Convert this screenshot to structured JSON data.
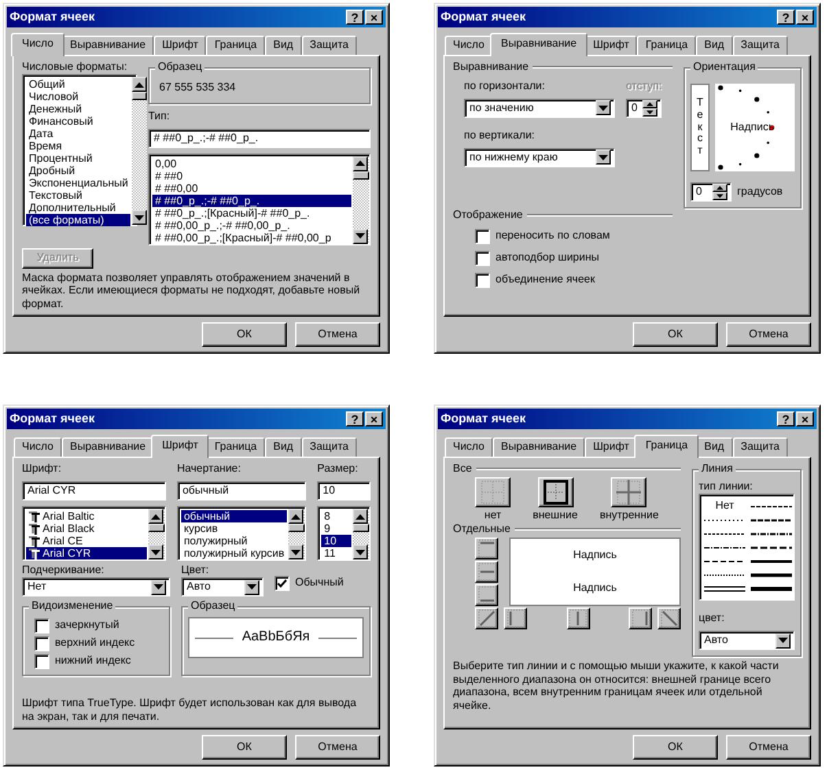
{
  "dialogs": [
    {
      "kind": "number",
      "title": "Формат ячеек",
      "title_buttons": [
        "?",
        "×"
      ],
      "tabs": [
        {
          "label": "Число",
          "selected": true
        },
        {
          "label": "Выравнивание",
          "selected": false
        },
        {
          "label": "Шрифт",
          "selected": false
        },
        {
          "label": "Граница",
          "selected": false
        },
        {
          "label": "Вид",
          "selected": false
        },
        {
          "label": "Защита",
          "selected": false
        }
      ],
      "formats_label": "Числовые форматы:",
      "formats": [
        {
          "label": "Общий",
          "selected": false
        },
        {
          "label": "Числовой",
          "selected": false
        },
        {
          "label": "Денежный",
          "selected": false
        },
        {
          "label": "Финансовый",
          "selected": false
        },
        {
          "label": "Дата",
          "selected": false
        },
        {
          "label": "Время",
          "selected": false
        },
        {
          "label": "Процентный",
          "selected": false
        },
        {
          "label": "Дробный",
          "selected": false
        },
        {
          "label": "Экспоненциальный",
          "selected": false
        },
        {
          "label": "Текстовый",
          "selected": false
        },
        {
          "label": "Дополнительный",
          "selected": false
        },
        {
          "label": "(все форматы)",
          "selected": true
        }
      ],
      "sample_label": "Образец",
      "sample_value": "67 555 535 334",
      "type_label": "Тип:",
      "type_value": "# ##0_р_.;-# ##0_р_.",
      "types": [
        {
          "label": "0,00",
          "selected": false
        },
        {
          "label": "# ##0",
          "selected": false
        },
        {
          "label": "# ##0,00",
          "selected": false
        },
        {
          "label": "# ##0_р_.;-# ##0_р_.",
          "selected": true
        },
        {
          "label": "# ##0_р_.;[Красный]-# ##0_р_.",
          "selected": false
        },
        {
          "label": "# ##0,00_р_.;-# ##0,00_р_.",
          "selected": false
        },
        {
          "label": "# ##0,00_р_.;[Красный]-# ##0,00_р",
          "selected": false
        }
      ],
      "delete_button": {
        "label": "Удалить",
        "disabled": true
      },
      "hint": "Маска формата позволяет управлять отображением значений в ячейках. Если имеющиеся форматы не подходят, добавьте новый формат.",
      "buttons": [
        "ОК",
        "Отмена"
      ]
    },
    {
      "kind": "alignment",
      "title": "Формат ячеек",
      "title_buttons": [
        "?",
        "×"
      ],
      "tabs": [
        {
          "label": "Число",
          "selected": false
        },
        {
          "label": "Выравнивание",
          "selected": true
        },
        {
          "label": "Шрифт",
          "selected": false
        },
        {
          "label": "Граница",
          "selected": false
        },
        {
          "label": "Вид",
          "selected": false
        },
        {
          "label": "Защита",
          "selected": false
        }
      ],
      "alignment_title": "Выравнивание",
      "horizontal_label": "по горизонтали:",
      "horizontal_value": "по значению",
      "indent": {
        "label": "отступ:",
        "value": "0",
        "disabled": true
      },
      "vertical_label": "по вертикали:",
      "vertical_value": "по нижнему краю",
      "display_title": "Отображение",
      "checkboxes": [
        {
          "label": "переносить по словам",
          "checked": false
        },
        {
          "label": "автоподбор ширины",
          "checked": false
        },
        {
          "label": "объединение ячеек",
          "checked": false
        }
      ],
      "orientation_title": "Ориентация",
      "vertical_text": "Текст",
      "rotated_text": "Надпись",
      "degrees_value": "0",
      "degrees_label": "градусов",
      "buttons": [
        "ОК",
        "Отмена"
      ]
    },
    {
      "kind": "font",
      "title": "Формат ячеек",
      "title_buttons": [
        "?",
        "×"
      ],
      "tabs": [
        {
          "label": "Число",
          "selected": false
        },
        {
          "label": "Выравнивание",
          "selected": false
        },
        {
          "label": "Шрифт",
          "selected": true
        },
        {
          "label": "Граница",
          "selected": false
        },
        {
          "label": "Вид",
          "selected": false
        },
        {
          "label": "Защита",
          "selected": false
        }
      ],
      "columns": [
        {
          "kind": "font",
          "label": "Шрифт:",
          "value": "Arial CYR",
          "items": [
            {
              "label": "Arial Baltic",
              "selected": false
            },
            {
              "label": "Arial Black",
              "selected": false
            },
            {
              "label": "Arial CE",
              "selected": false
            },
            {
              "label": "Arial CYR",
              "selected": true
            }
          ]
        },
        {
          "kind": "style",
          "label": "Начертание:",
          "value": "обычный",
          "items": [
            {
              "label": "обычный",
              "selected": true
            },
            {
              "label": "курсив",
              "selected": false
            },
            {
              "label": "полужирный",
              "selected": false
            },
            {
              "label": "полужирный курсив",
              "selected": false
            }
          ]
        },
        {
          "kind": "size",
          "label": "Размер:",
          "value": "10",
          "items": [
            {
              "label": "8",
              "selected": false
            },
            {
              "label": "9",
              "selected": false
            },
            {
              "label": "10",
              "selected": true
            },
            {
              "label": "11",
              "selected": false
            }
          ]
        }
      ],
      "underline": {
        "label": "Подчеркивание:",
        "value": "Нет"
      },
      "color": {
        "label": "Цвет:",
        "value": "Авто"
      },
      "normal_checkbox": {
        "label": "Обычный",
        "checked": true
      },
      "effects_title": "Видоизменение",
      "effects": [
        {
          "label": "зачеркнутый",
          "checked": false
        },
        {
          "label": "верхний индекс",
          "checked": false
        },
        {
          "label": "нижний индекс",
          "checked": false
        }
      ],
      "sample_title": "Образец",
      "sample_text": "AaBbБбЯя",
      "hint": "Шрифт типа TrueType. Шрифт будет использован как для вывода на экран, так и для печати.",
      "buttons": [
        "ОК",
        "Отмена"
      ]
    },
    {
      "kind": "border",
      "title": "Формат ячеек",
      "title_buttons": [
        "?",
        "×"
      ],
      "tabs": [
        {
          "label": "Число",
          "selected": false
        },
        {
          "label": "Выравнивание",
          "selected": false
        },
        {
          "label": "Шрифт",
          "selected": false
        },
        {
          "label": "Граница",
          "selected": true
        },
        {
          "label": "Вид",
          "selected": false
        },
        {
          "label": "Защита",
          "selected": false
        }
      ],
      "presets_title": "Все",
      "presets": [
        {
          "kind": "none",
          "label": "нет",
          "disabled": true
        },
        {
          "kind": "outline",
          "label": "внешние",
          "disabled": false
        },
        {
          "kind": "inside",
          "label": "внутренние",
          "disabled": true
        }
      ],
      "individual_title": "Отдельные",
      "preview_labels": [
        "Надпись",
        "Надпись"
      ],
      "line_title": "Линия",
      "line_type_label": "тип линии:",
      "line_none": "Нет",
      "color_label": "цвет:",
      "color_value": "Авто",
      "hint": "Выберите тип линии и с помощью мыши укажите, к какой части выделенного диапазона он относится: внешней границе всего диапазона, всем внутренним границам ячеек или отдельной ячейке.",
      "buttons": [
        "ОК",
        "Отмена"
      ]
    }
  ]
}
